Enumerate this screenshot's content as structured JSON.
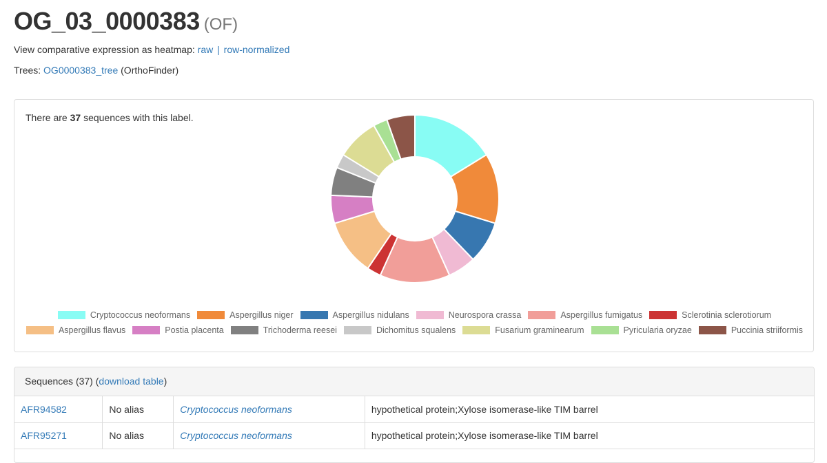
{
  "header": {
    "title": "OG_03_0000383",
    "tag": "(OF)"
  },
  "heatmap": {
    "label": "View comparative expression as heatmap:",
    "raw": "raw",
    "separator": "|",
    "normalized": "row-normalized"
  },
  "trees": {
    "label": "Trees:",
    "link": "OG0000383_tree",
    "suffix": "(OrthoFinder)"
  },
  "summary": {
    "prefix": "There are",
    "count": "37",
    "suffix": "sequences with this label."
  },
  "chart_data": {
    "type": "pie",
    "variant": "doughnut",
    "legend_position": "bottom",
    "series": [
      {
        "name": "Cryptococcus neoformans",
        "value": 6,
        "color": "#88fcf4"
      },
      {
        "name": "Aspergillus niger",
        "value": 5,
        "color": "#f08a3a"
      },
      {
        "name": "Aspergillus nidulans",
        "value": 3,
        "color": "#3777b0"
      },
      {
        "name": "Neurospora crassa",
        "value": 2,
        "color": "#f0bad3"
      },
      {
        "name": "Aspergillus fumigatus",
        "value": 5,
        "color": "#f19e99"
      },
      {
        "name": "Sclerotinia sclerotiorum",
        "value": 1,
        "color": "#cc3333"
      },
      {
        "name": "Aspergillus flavus",
        "value": 4,
        "color": "#f5bf85"
      },
      {
        "name": "Postia placenta",
        "value": 2,
        "color": "#d67fc4"
      },
      {
        "name": "Trichoderma reesei",
        "value": 2,
        "color": "#808080"
      },
      {
        "name": "Dichomitus squalens",
        "value": 1,
        "color": "#c8c8c8"
      },
      {
        "name": "Fusarium graminearum",
        "value": 3,
        "color": "#dcdc94"
      },
      {
        "name": "Pyricularia oryzae",
        "value": 1,
        "color": "#a9e094"
      },
      {
        "name": "Puccinia striiformis",
        "value": 2,
        "color": "#8c5548"
      }
    ]
  },
  "sequences": {
    "title": "Sequences (37)",
    "open_paren": "(",
    "download": "download table",
    "close_paren": ")",
    "rows": [
      {
        "id": "AFR94582",
        "alias": "No alias",
        "species": "Cryptococcus neoformans",
        "description": "hypothetical protein;Xylose isomerase-like TIM barrel"
      },
      {
        "id": "AFR95271",
        "alias": "No alias",
        "species": "Cryptococcus neoformans",
        "description": "hypothetical protein;Xylose isomerase-like TIM barrel"
      }
    ]
  }
}
